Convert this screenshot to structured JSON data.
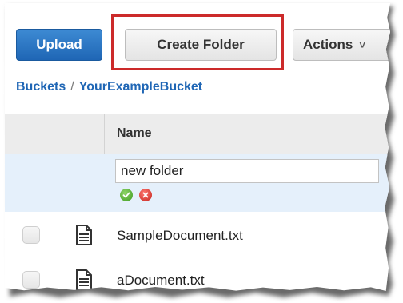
{
  "toolbar": {
    "upload_label": "Upload",
    "create_folder_label": "Create Folder",
    "actions_label": "Actions",
    "actions_chevron": "˅"
  },
  "breadcrumb": {
    "root": "Buckets",
    "separator": "/",
    "current": "YourExampleBucket"
  },
  "table": {
    "column_name": "Name"
  },
  "new_folder": {
    "value": "new folder"
  },
  "files": [
    {
      "name": "SampleDocument.txt"
    },
    {
      "name": "aDocument.txt"
    }
  ],
  "icons": {
    "confirm": "check-circle-icon",
    "cancel": "close-circle-icon",
    "file": "document-icon"
  },
  "colors": {
    "upload_bg": "#1f66b5",
    "highlight": "#cc2a2a",
    "link": "#1f66b5",
    "new_row_bg": "#e5f0fb",
    "confirm": "#3c9a1d",
    "cancel": "#c3211b"
  }
}
